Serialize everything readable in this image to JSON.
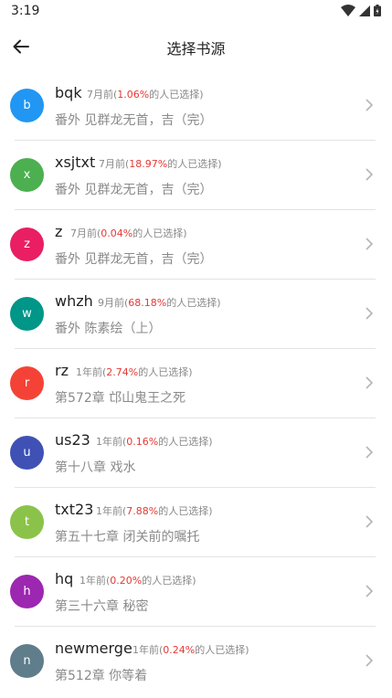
{
  "status": {
    "time": "3:19"
  },
  "header": {
    "title": "选择书源"
  },
  "sources": [
    {
      "name": "bqk",
      "avatar": "b",
      "color": "#2196F3",
      "age": "7月前(",
      "pct": "1.06%",
      "suffix": "的人已选择)",
      "chapter": "番外 见群龙无首，吉（完）"
    },
    {
      "name": "xsjtxt",
      "avatar": "x",
      "color": "#4CAF50",
      "age": "7月前(",
      "pct": "18.97%",
      "suffix": "的人已选择)",
      "chapter": "番外 见群龙无首，吉（完）"
    },
    {
      "name": "z",
      "avatar": "z",
      "color": "#E91E63",
      "age": "7月前(",
      "pct": "0.04%",
      "suffix": "的人已选择)",
      "chapter": "番外 见群龙无首，吉（完）"
    },
    {
      "name": "whzh",
      "avatar": "w",
      "color": "#009688",
      "age": "9月前(",
      "pct": "68.18%",
      "suffix": "的人已选择)",
      "chapter": "番外 陈素绘（上）"
    },
    {
      "name": "rz",
      "avatar": "r",
      "color": "#F44336",
      "age": "1年前(",
      "pct": "2.74%",
      "suffix": "的人已选择)",
      "chapter": "第572章 邙山鬼王之死"
    },
    {
      "name": "us23",
      "avatar": "u",
      "color": "#3F51B5",
      "age": "1年前(",
      "pct": "0.16%",
      "suffix": "的人已选择)",
      "chapter": "第十八章 戏水"
    },
    {
      "name": "txt23",
      "avatar": "t",
      "color": "#8BC34A",
      "age": "1年前(",
      "pct": "7.88%",
      "suffix": "的人已选择)",
      "chapter": "第五十七章 闭关前的嘱托"
    },
    {
      "name": "hq",
      "avatar": "h",
      "color": "#9C27B0",
      "age": "1年前(",
      "pct": "0.20%",
      "suffix": "的人已选择)",
      "chapter": "第三十六章 秘密"
    },
    {
      "name": "newmerge",
      "avatar": "n",
      "color": "#607D8B",
      "age": "1年前(",
      "pct": "0.24%",
      "suffix": "的人已选择)",
      "chapter": "第512章 你等着"
    }
  ]
}
